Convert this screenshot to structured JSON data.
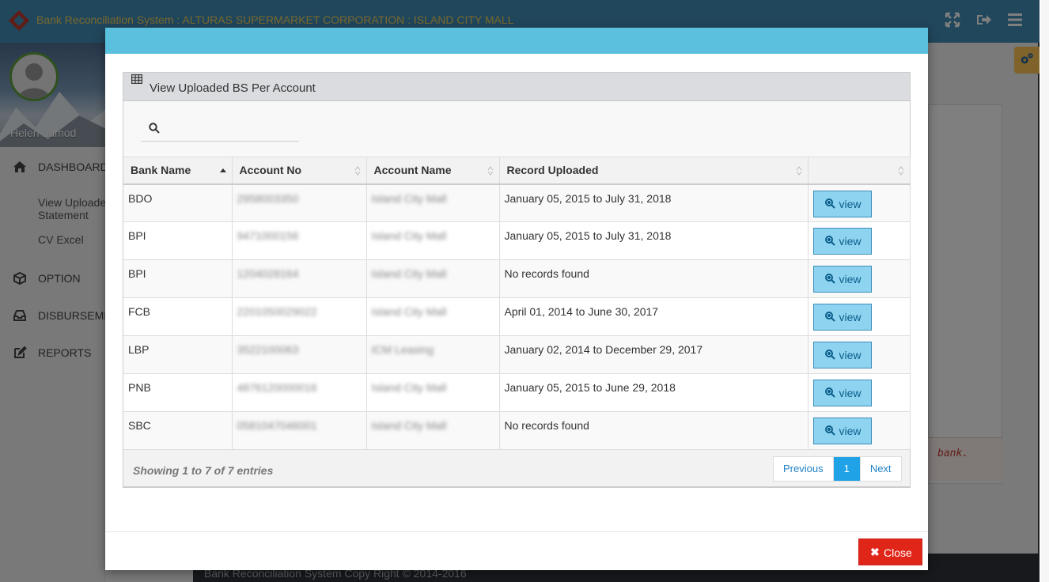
{
  "app": {
    "title": "Bank Reconciliation System : ALTURAS SUPERMARKET CORPORATION : ISLAND CITY MALL",
    "user_name": "Helen Lumod",
    "footer": "Bank Reconciliation System Copy Right © 2014-2016",
    "note_fragment": "bank."
  },
  "sidebar": {
    "dashboard": "DASHBOARD",
    "sub_items": [
      "View Uploaded",
      "Statement",
      "CV Excel"
    ],
    "option": "OPTION",
    "disbursement": "DISBURSEMENT",
    "reports": "REPORTS"
  },
  "modal": {
    "panel_title": "View Uploaded BS Per Account",
    "search": {
      "value": "",
      "placeholder": ""
    },
    "columns": [
      "Bank Name",
      "Account No",
      "Account Name",
      "Record Uploaded",
      ""
    ],
    "rows": [
      {
        "bank": "BDO",
        "account_no": "2958003350",
        "account_name": "Island City Mall",
        "record": "January 05, 2015 to July 31, 2018",
        "action": "view"
      },
      {
        "bank": "BPI",
        "account_no": "9471000156",
        "account_name": "Island City Mall",
        "record": "January 05, 2015 to July 31, 2018",
        "action": "view"
      },
      {
        "bank": "BPI",
        "account_no": "1204028164",
        "account_name": "Island City Mall",
        "record": "No records found",
        "action": "view"
      },
      {
        "bank": "FCB",
        "account_no": "2201050029022",
        "account_name": "Island City Mall",
        "record": "April 01, 2014 to June 30, 2017",
        "action": "view"
      },
      {
        "bank": "LBP",
        "account_no": "3522100063",
        "account_name": "ICM Leasing",
        "record": "January 02, 2014 to December 29, 2017",
        "action": "view"
      },
      {
        "bank": "PNB",
        "account_no": "4876120000016",
        "account_name": "Island City Mall",
        "record": "January 05, 2015 to June 29, 2018",
        "action": "view"
      },
      {
        "bank": "SBC",
        "account_no": "0581047046001",
        "account_name": "Island City Mall",
        "record": "No records found",
        "action": "view"
      }
    ],
    "showing": "Showing 1 to 7 of 7 entries",
    "pagination": {
      "previous": "Previous",
      "current": "1",
      "next": "Next"
    },
    "close_label": "Close"
  },
  "colors": {
    "topbar": "#438eb9",
    "modal_header": "#5bc0de",
    "view_button": "#8ed3ef",
    "close_button": "#e02618",
    "active_page": "#1fa2e6"
  },
  "icons": [
    "logo-icon",
    "fullscreen-icon",
    "logout-icon",
    "menu-icon",
    "gear-icon",
    "home-icon",
    "cube-icon",
    "inbox-icon",
    "edit-icon",
    "table-grid-icon",
    "search-icon",
    "sort-icon",
    "zoom-in-icon",
    "close-icon"
  ]
}
